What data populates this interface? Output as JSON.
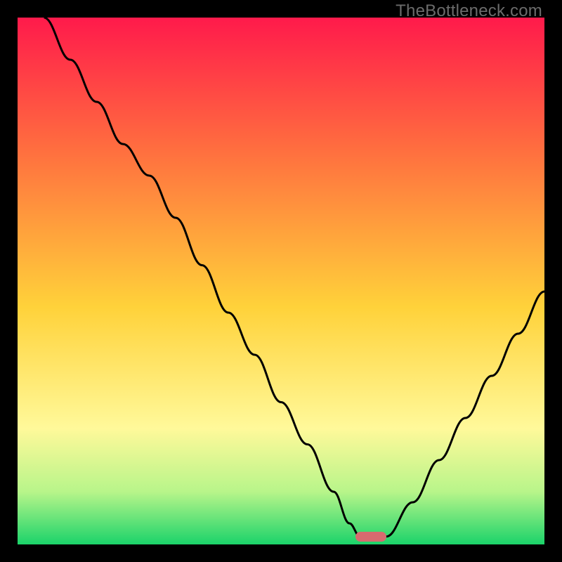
{
  "watermark": "TheBottleneck.com",
  "colors": {
    "top": "#ff1a4b",
    "upper_mid": "#ff6e3f",
    "mid": "#ffd23a",
    "lower_mid": "#fff99a",
    "near_bottom": "#b8f58a",
    "bottom": "#1bd36a",
    "curve": "#000000",
    "marker": "#d86a6f"
  },
  "chart_data": {
    "type": "line",
    "title": "",
    "xlabel": "",
    "ylabel": "",
    "xlim": [
      0,
      100
    ],
    "ylim": [
      0,
      100
    ],
    "grid": false,
    "legend": false,
    "annotations": [
      {
        "text": "TheBottleneck.com",
        "pos": "top-right"
      }
    ],
    "marker": {
      "x": 67,
      "y": 1.5,
      "shape": "pill",
      "color": "#d86a6f"
    },
    "series": [
      {
        "name": "bottleneck-curve",
        "color": "#000000",
        "x": [
          5,
          10,
          15,
          20,
          25,
          30,
          35,
          40,
          45,
          50,
          55,
          60,
          63,
          65,
          67,
          70,
          75,
          80,
          85,
          90,
          95,
          100
        ],
        "y": [
          100,
          92,
          84,
          76,
          70,
          62,
          53,
          44,
          36,
          27,
          19,
          10,
          4,
          1.5,
          1.5,
          1.5,
          8,
          16,
          24,
          32,
          40,
          48
        ]
      }
    ],
    "background_gradient_stops": [
      {
        "pos": 0.0,
        "color": "#ff1a4b"
      },
      {
        "pos": 0.25,
        "color": "#ff6e3f"
      },
      {
        "pos": 0.55,
        "color": "#ffd23a"
      },
      {
        "pos": 0.78,
        "color": "#fff99a"
      },
      {
        "pos": 0.9,
        "color": "#b8f58a"
      },
      {
        "pos": 1.0,
        "color": "#1bd36a"
      }
    ]
  }
}
